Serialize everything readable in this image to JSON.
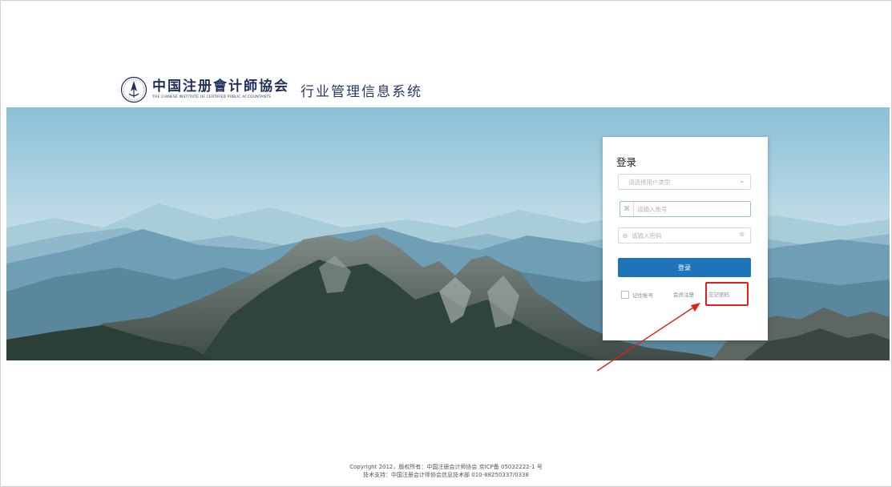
{
  "header": {
    "org_name_cn": "中国注册會计師協会",
    "org_name_en": "THE CHINESE INSTITUTE OF CERTIFIED PUBLIC ACCOUNTANTS",
    "system_title": "行业管理信息系统",
    "emblem_icon": "cicpa-emblem-icon"
  },
  "login": {
    "title": "登录",
    "user_type_placeholder": "请选择用户类型",
    "account_placeholder": "请输入账号",
    "password_placeholder": "请输入密码",
    "submit_label": "登录",
    "remember_label": "记住账号",
    "register_label": "会员注册",
    "forgot_label": "忘记密码"
  },
  "footer": {
    "line1": "Copyright 2012，版权所有：中国注册会计师协会 京ICP备 05032222-1 号",
    "line2": "技术支持：中国注册会计师协会信息技术部 010-88250337/0338"
  },
  "colors": {
    "primary": "#1f74b9",
    "annotation": "#e0201b",
    "brand": "#1f2f5c"
  }
}
